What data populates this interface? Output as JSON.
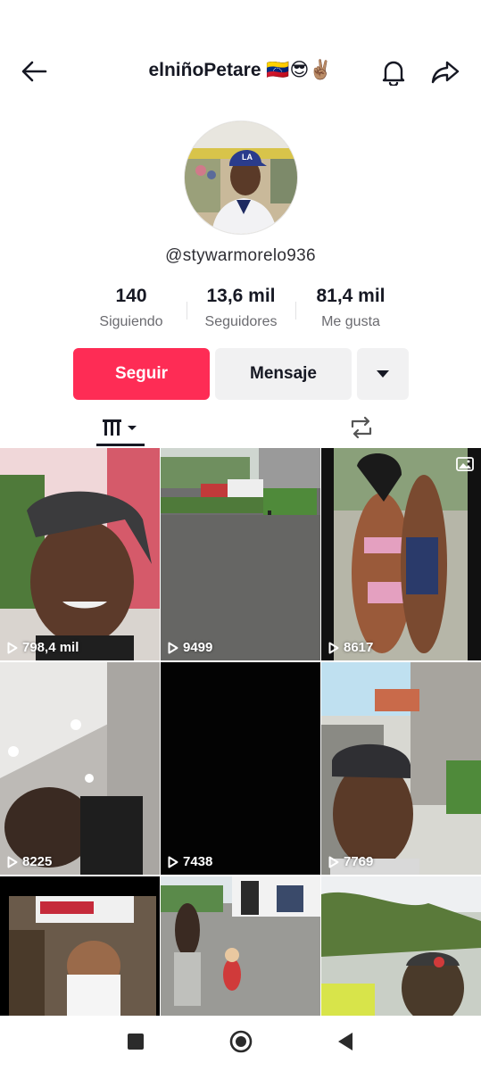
{
  "header": {
    "title": "elniñoPetare 🇻🇪😎✌🏽",
    "back_icon": "arrow-left-icon",
    "notification_icon": "bell-icon",
    "share_icon": "share-arrow-icon"
  },
  "profile": {
    "username": "@stywarmorelo936",
    "stats": [
      {
        "value": "140",
        "label": "Siguiendo"
      },
      {
        "value": "13,6 mil",
        "label": "Seguidores"
      },
      {
        "value": "81,4 mil",
        "label": "Me gusta"
      }
    ]
  },
  "actions": {
    "follow_label": "Seguir",
    "message_label": "Mensaje",
    "more_icon": "caret-down-icon"
  },
  "colors": {
    "accent": "#fe2c55",
    "text": "#161823",
    "muted": "#6b6b70",
    "button_gray": "#f1f1f2"
  },
  "tabs": {
    "videos_icon": "grid-columns-icon",
    "reposts_icon": "repost-icon"
  },
  "videos": [
    {
      "views": "798,4 mil"
    },
    {
      "views": "9499"
    },
    {
      "views": "8617",
      "badge_icon": "photo-icon"
    },
    {
      "views": "8225"
    },
    {
      "views": "7438"
    },
    {
      "views": "7769"
    },
    {
      "views": ""
    },
    {
      "views": ""
    },
    {
      "views": ""
    }
  ],
  "navbar": {
    "recents_icon": "square-icon",
    "home_icon": "circle-home-icon",
    "back_icon": "triangle-back-icon"
  }
}
